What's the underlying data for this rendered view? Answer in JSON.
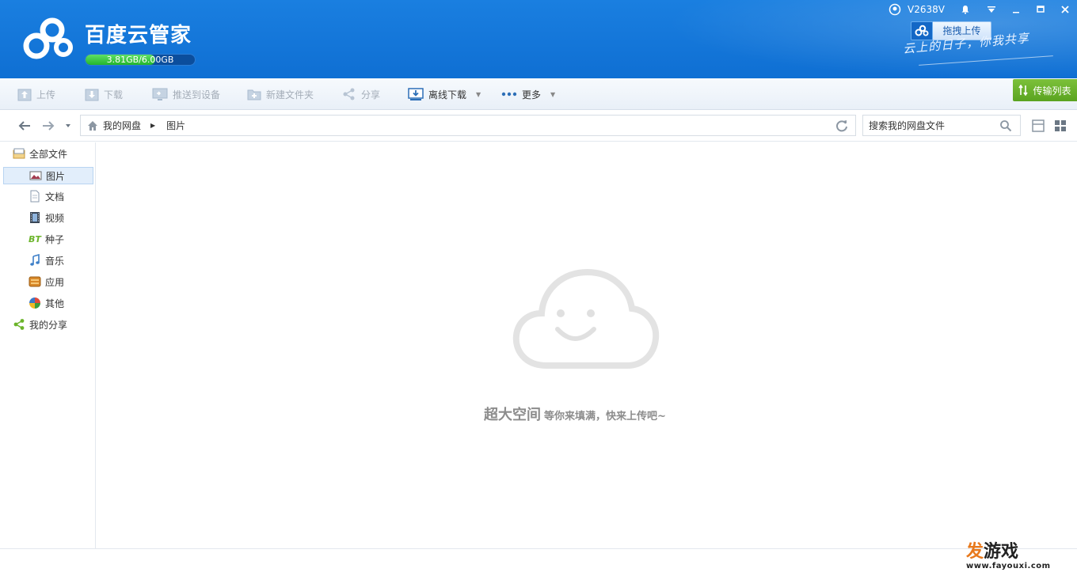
{
  "app": {
    "title": "百度云管家",
    "quota": {
      "text": "3.81GB/6.00GB",
      "used_fraction": 0.635
    },
    "user": {
      "name": "V2638V"
    },
    "drag_upload_label": "拖拽上传",
    "slogan": "云上的日子，你我共享"
  },
  "toolbar": {
    "upload": "上传",
    "download": "下载",
    "push_device": "推送到设备",
    "new_folder": "新建文件夹",
    "share": "分享",
    "offline_download": "离线下载",
    "more": "更多",
    "transfer_list": "传输列表"
  },
  "nav": {
    "breadcrumb": [
      "我的网盘",
      "图片"
    ],
    "search_placeholder": "搜索我的网盘文件"
  },
  "sidebar": {
    "items": [
      {
        "label": "全部文件",
        "icon": "folder-icon"
      },
      {
        "label": "图片",
        "icon": "picture-icon"
      },
      {
        "label": "文档",
        "icon": "document-icon"
      },
      {
        "label": "视频",
        "icon": "video-icon"
      },
      {
        "label": "种子",
        "icon": "bt-icon",
        "badge": "BT"
      },
      {
        "label": "音乐",
        "icon": "music-icon"
      },
      {
        "label": "应用",
        "icon": "app-icon"
      },
      {
        "label": "其他",
        "icon": "other-icon"
      },
      {
        "label": "我的分享",
        "icon": "share-icon"
      }
    ]
  },
  "main": {
    "empty_title": "超大空间",
    "empty_subtitle": "等你来填满，快来上传吧~"
  },
  "watermark": {
    "brand_a": "发",
    "brand_b": "游戏",
    "url": "www.fayouxi.com"
  },
  "colors": {
    "header": "#1a7fe0",
    "accent_green": "#5aa320",
    "active_item": "#e2eefb"
  }
}
